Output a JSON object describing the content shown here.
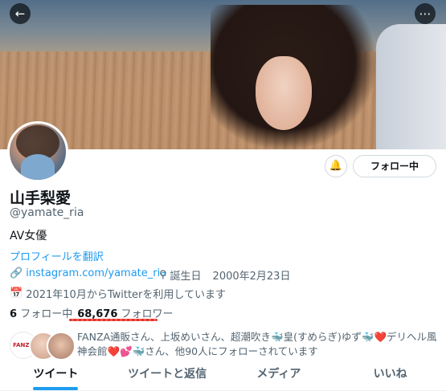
{
  "header": {
    "back_icon": "arrow-left-icon",
    "more_icon": "more-horizontal-icon"
  },
  "profile": {
    "name": "山手梨愛",
    "handle": "@yamate_ria",
    "bio": "AV女優",
    "translate_label": "プロフィールを翻訳",
    "link": "instagram.com/yamate_ria",
    "birthday_label": "誕生日",
    "birthday_value": "2000年2月23日",
    "joined": "2021年10月からTwitterを利用しています",
    "following_count": "6",
    "following_label": "フォロー中",
    "followers_count": "68,676",
    "followers_label": "フォロワー",
    "follow_button_label": "フォロー中",
    "bell_icon": "bell-plus-icon"
  },
  "followed_by": {
    "avatar1_text": "FANZA",
    "text": "FANZA通販さん、上坂めいさん、超潮吹き🐳皇(すめらぎ)ゆず🐳❤️デリヘル風神会館❤️💕🐳さん、他90人にフォローされています"
  },
  "tabs": [
    {
      "label": "ツイート",
      "active": true
    },
    {
      "label": "ツイートと返信",
      "active": false
    },
    {
      "label": "メディア",
      "active": false
    },
    {
      "label": "いいね",
      "active": false
    }
  ],
  "colors": {
    "accent": "#1d9bf0",
    "text": "#0f1419",
    "muted": "#536471"
  }
}
